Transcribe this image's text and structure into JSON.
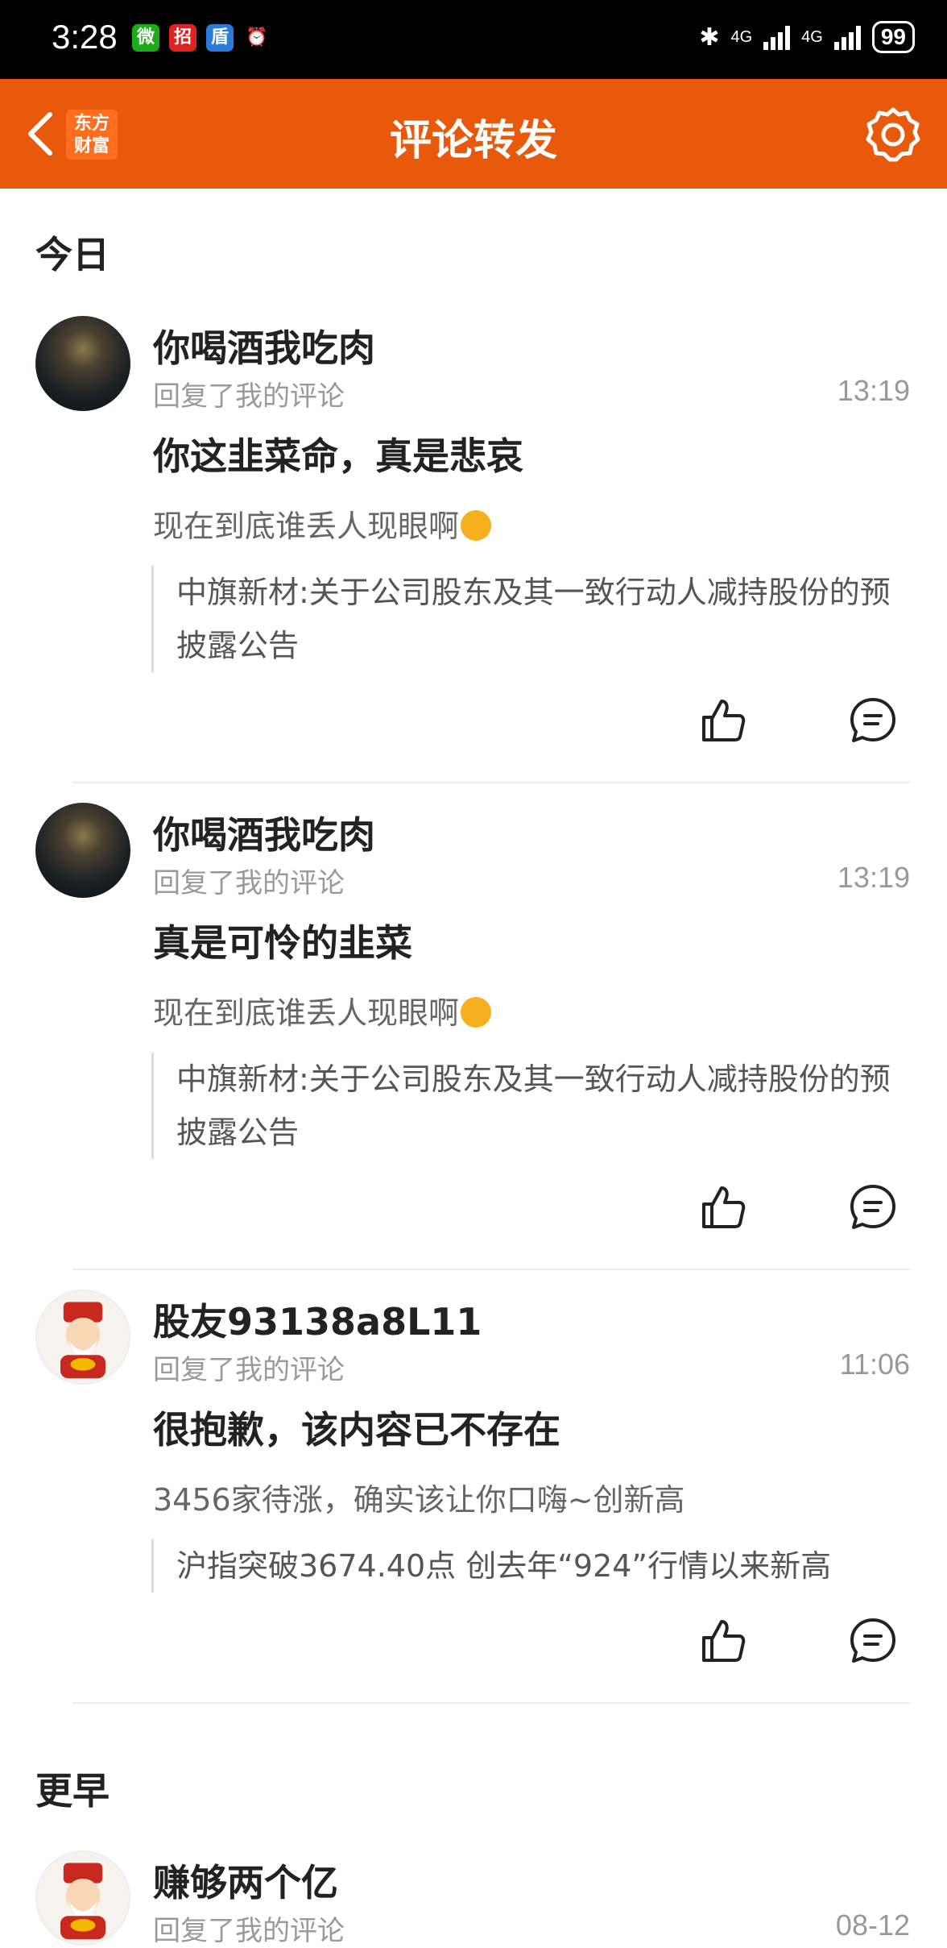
{
  "status_bar": {
    "time": "3:28",
    "apps": [
      "微",
      "招",
      "盾",
      "⏰"
    ],
    "network": "4G",
    "battery": "99"
  },
  "header": {
    "title": "评论转发",
    "logo_line1": "东方",
    "logo_line2": "财富"
  },
  "sections": {
    "today": "今日",
    "earlier": "更早"
  },
  "items": [
    {
      "user": "你喝酒我吃肉",
      "action": "回复了我的评论",
      "time": "13:19",
      "reply": "你这韭菜命，真是悲哀",
      "original": "现在到底谁丢人现眼啊",
      "quote": "中旗新材:关于公司股东及其一致行动人减持股份的预披露公告"
    },
    {
      "user": "你喝酒我吃肉",
      "action": "回复了我的评论",
      "time": "13:19",
      "reply": "真是可怜的韭菜",
      "original": "现在到底谁丢人现眼啊",
      "quote": "中旗新材:关于公司股东及其一致行动人减持股份的预披露公告"
    },
    {
      "user": "股友93138a8L11",
      "action": "回复了我的评论",
      "time": "11:06",
      "reply": " 很抱歉，该内容已不存在",
      "original": "3456家待涨，确实该让你口嗨~创新高",
      "quote": "沪指突破3674.40点 创去年“924”行情以来新高"
    },
    {
      "user": "赚够两个亿",
      "action": "回复了我的评论",
      "time": "08-12"
    }
  ],
  "colors": {
    "brand": "#e8590c",
    "muted": "#999999"
  },
  "icons": {
    "back": "chevron-left-icon",
    "settings": "gear-icon",
    "like": "thumbs-up-icon",
    "comment": "comment-icon"
  }
}
